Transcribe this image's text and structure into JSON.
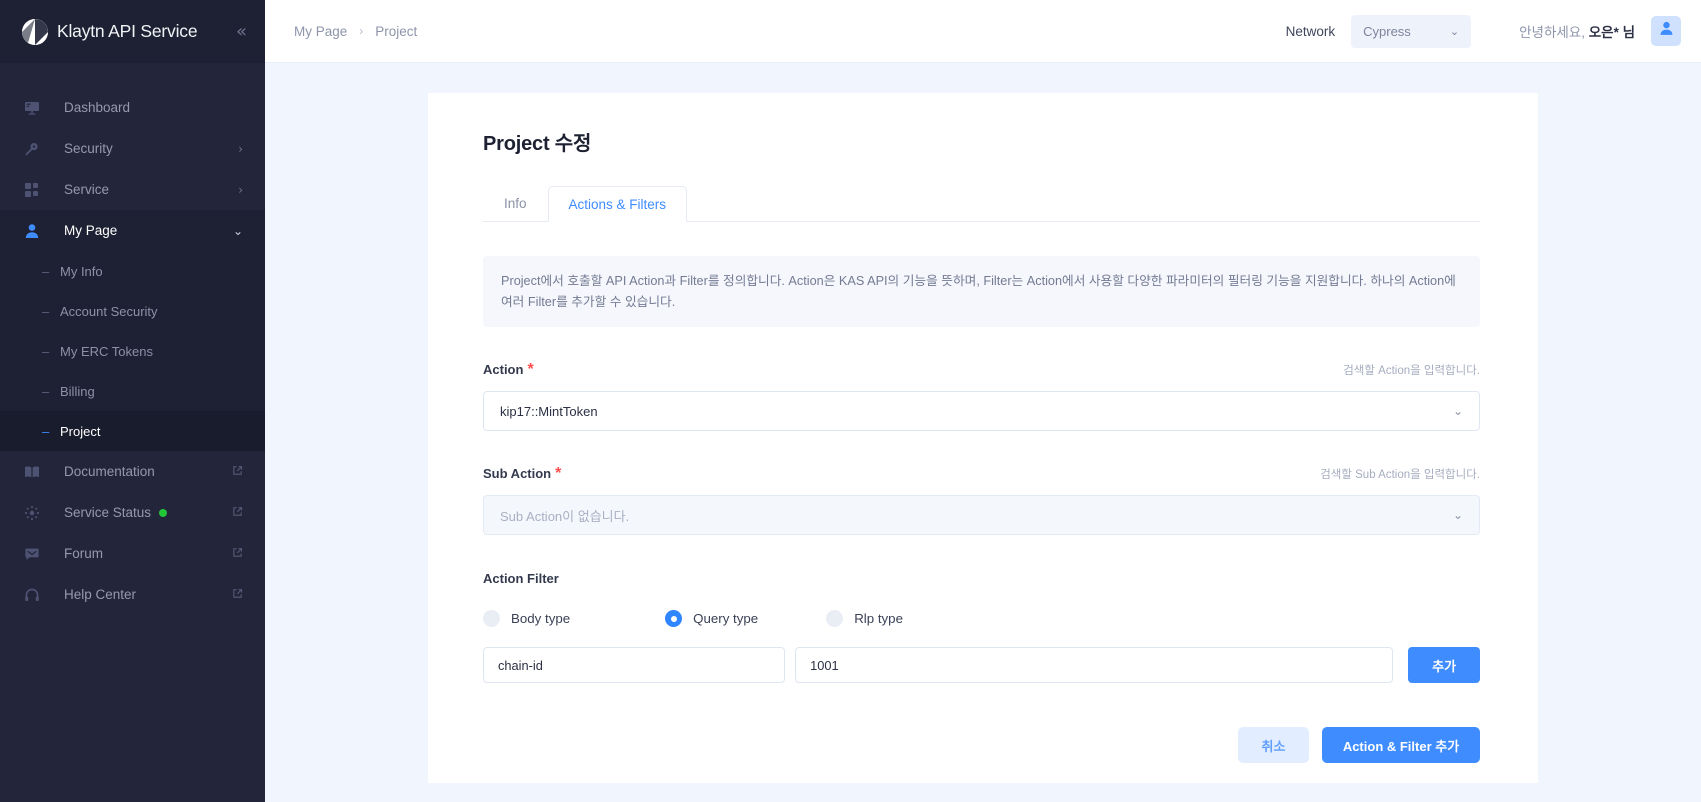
{
  "sidebar": {
    "brand": "Klaytn API Service",
    "collapse_icon": "chevrons-left-icon",
    "items": [
      {
        "label": "Dashboard",
        "icon": "dashboard-icon"
      },
      {
        "label": "Security",
        "icon": "key-icon",
        "chevron": "chevron-right-icon"
      },
      {
        "label": "Service",
        "icon": "grid-icon",
        "chevron": "chevron-right-icon"
      },
      {
        "label": "My Page",
        "icon": "user-icon",
        "chevron": "chevron-down-icon"
      }
    ],
    "sub_items": [
      {
        "label": "My Info"
      },
      {
        "label": "Account Security"
      },
      {
        "label": "My ERC Tokens"
      },
      {
        "label": "Billing"
      },
      {
        "label": "Project"
      }
    ],
    "external_items": [
      {
        "label": "Documentation",
        "icon": "book-icon",
        "external_icon": "external-link-icon"
      },
      {
        "label": "Service Status",
        "icon": "sun-icon",
        "external_icon": "external-link-icon",
        "status": "online"
      },
      {
        "label": "Forum",
        "icon": "chat-icon",
        "external_icon": "external-link-icon"
      },
      {
        "label": "Help Center",
        "icon": "headset-icon",
        "external_icon": "external-link-icon"
      }
    ]
  },
  "topbar": {
    "breadcrumb": [
      "My Page",
      "Project"
    ],
    "breadcrumb_separator": "›",
    "network_label": "Network",
    "network_value": "Cypress",
    "network_chevron": "chevron-down-icon",
    "greeting_prefix": "안녕하세요, ",
    "greeting_name": "오은* 님",
    "avatar_icon": "user-avatar-icon"
  },
  "page": {
    "title": "Project 수정",
    "tabs": [
      {
        "label": "Info",
        "active": false
      },
      {
        "label": "Actions & Filters",
        "active": true
      }
    ],
    "banner": "Project에서 호출할 API Action과 Filter를 정의합니다. Action은 KAS API의 기능을 뜻하며, Filter는 Action에서 사용할 다양한 파라미터의 필터링 기능을 지원합니다. 하나의 Action에 여러 Filter를 추가할 수 있습니다.",
    "action": {
      "label": "Action",
      "required_mark": "*",
      "hint": "검색할 Action을 입력합니다.",
      "value": "kip17::MintToken",
      "chevron": "chevron-down-icon"
    },
    "sub_action": {
      "label": "Sub Action",
      "required_mark": "*",
      "hint": "검색할 Sub Action을 입력합니다.",
      "placeholder": "Sub Action이 없습니다.",
      "chevron": "chevron-down-icon"
    },
    "action_filter": {
      "title": "Action Filter",
      "options": [
        {
          "label": "Body type",
          "selected": false
        },
        {
          "label": "Query type",
          "selected": true
        },
        {
          "label": "Rlp type",
          "selected": false
        }
      ],
      "key_value": "chain-id",
      "key_placeholder": "",
      "value_value": "1001",
      "value_placeholder": "",
      "add_label": "추가"
    },
    "footer": {
      "cancel_label": "취소",
      "submit_label": "Action & Filter 추가"
    }
  },
  "colors": {
    "accent": "#3f8cff",
    "sidebar_bg": "#23263a",
    "page_bg": "#f1f5fd",
    "required": "#ff4d4f",
    "status_online": "#22c538"
  }
}
